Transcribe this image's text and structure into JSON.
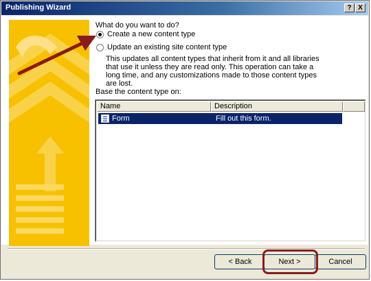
{
  "window": {
    "title": "Publishing Wizard",
    "help_button": "?",
    "close_button": "X"
  },
  "question": "What do you want to do?",
  "options": [
    {
      "label": "Create a new content type",
      "selected": true
    },
    {
      "label": "Update an existing site content type",
      "selected": false
    }
  ],
  "option_description": "This updates all content types that inherit from it and all libraries that use it unless they are read only. This operation can take a long time, and any customizations made to those content types are lost.",
  "base_label": "Base the content type on:",
  "list": {
    "columns": [
      "Name",
      "Description"
    ],
    "rows": [
      {
        "name": "Form",
        "description": "Fill out this form.",
        "selected": true
      }
    ]
  },
  "buttons": {
    "back": "< Back",
    "next": "Next >",
    "cancel": "Cancel"
  },
  "colors": {
    "sidebar": "#f7c100",
    "title_bar": "#0a246a",
    "selection": "#0a246a",
    "annotation": "#8b1a1a"
  }
}
